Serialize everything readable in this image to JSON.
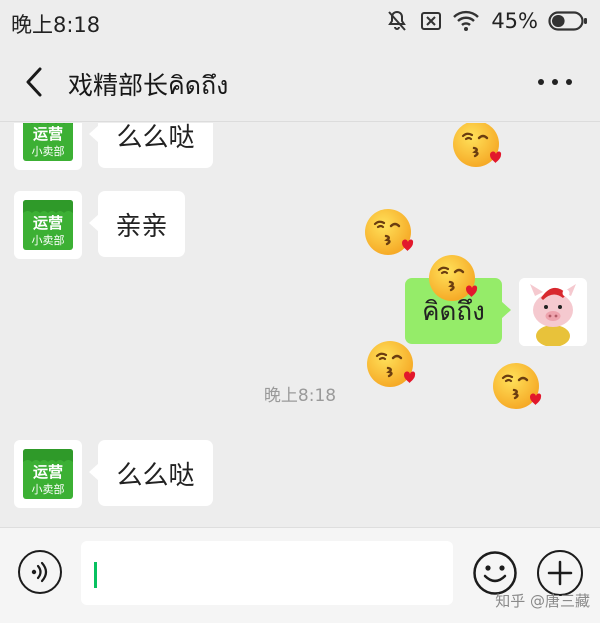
{
  "status_bar": {
    "time": "晚上8:18",
    "battery_percent": "45%",
    "battery_level": 0.45,
    "icons": [
      "mute-icon",
      "no-sim-icon",
      "wifi-icon",
      "battery-icon"
    ]
  },
  "nav": {
    "title": "戏精部长คิดถึง",
    "back_icon": "chevron-left-icon",
    "more_icon": "more-dots-icon"
  },
  "messages": [
    {
      "side": "in",
      "sender": "运营小卖部",
      "text": "么么哒"
    },
    {
      "side": "in",
      "sender": "运营小卖部",
      "text": "亲亲"
    },
    {
      "side": "out",
      "text": "คิดถึง"
    },
    {
      "side": "in",
      "sender": "运营小卖部",
      "text": "么么哒"
    }
  ],
  "timestamp": "晚上8:18",
  "avatar_shop": {
    "line1": "运营",
    "line2": "小卖部",
    "color": "#3cb034"
  },
  "emoji_name": "face-blowing-kiss-emoji",
  "input_bar": {
    "value": "",
    "voice_icon": "voice-icon",
    "emoji_icon": "smiley-icon",
    "plus_icon": "plus-icon",
    "watermark": "知乎 @唐三藏"
  },
  "colors": {
    "background": "#ededed",
    "bubble_out": "#95ec69",
    "bubble_in": "#ffffff",
    "caret": "#07c160"
  }
}
